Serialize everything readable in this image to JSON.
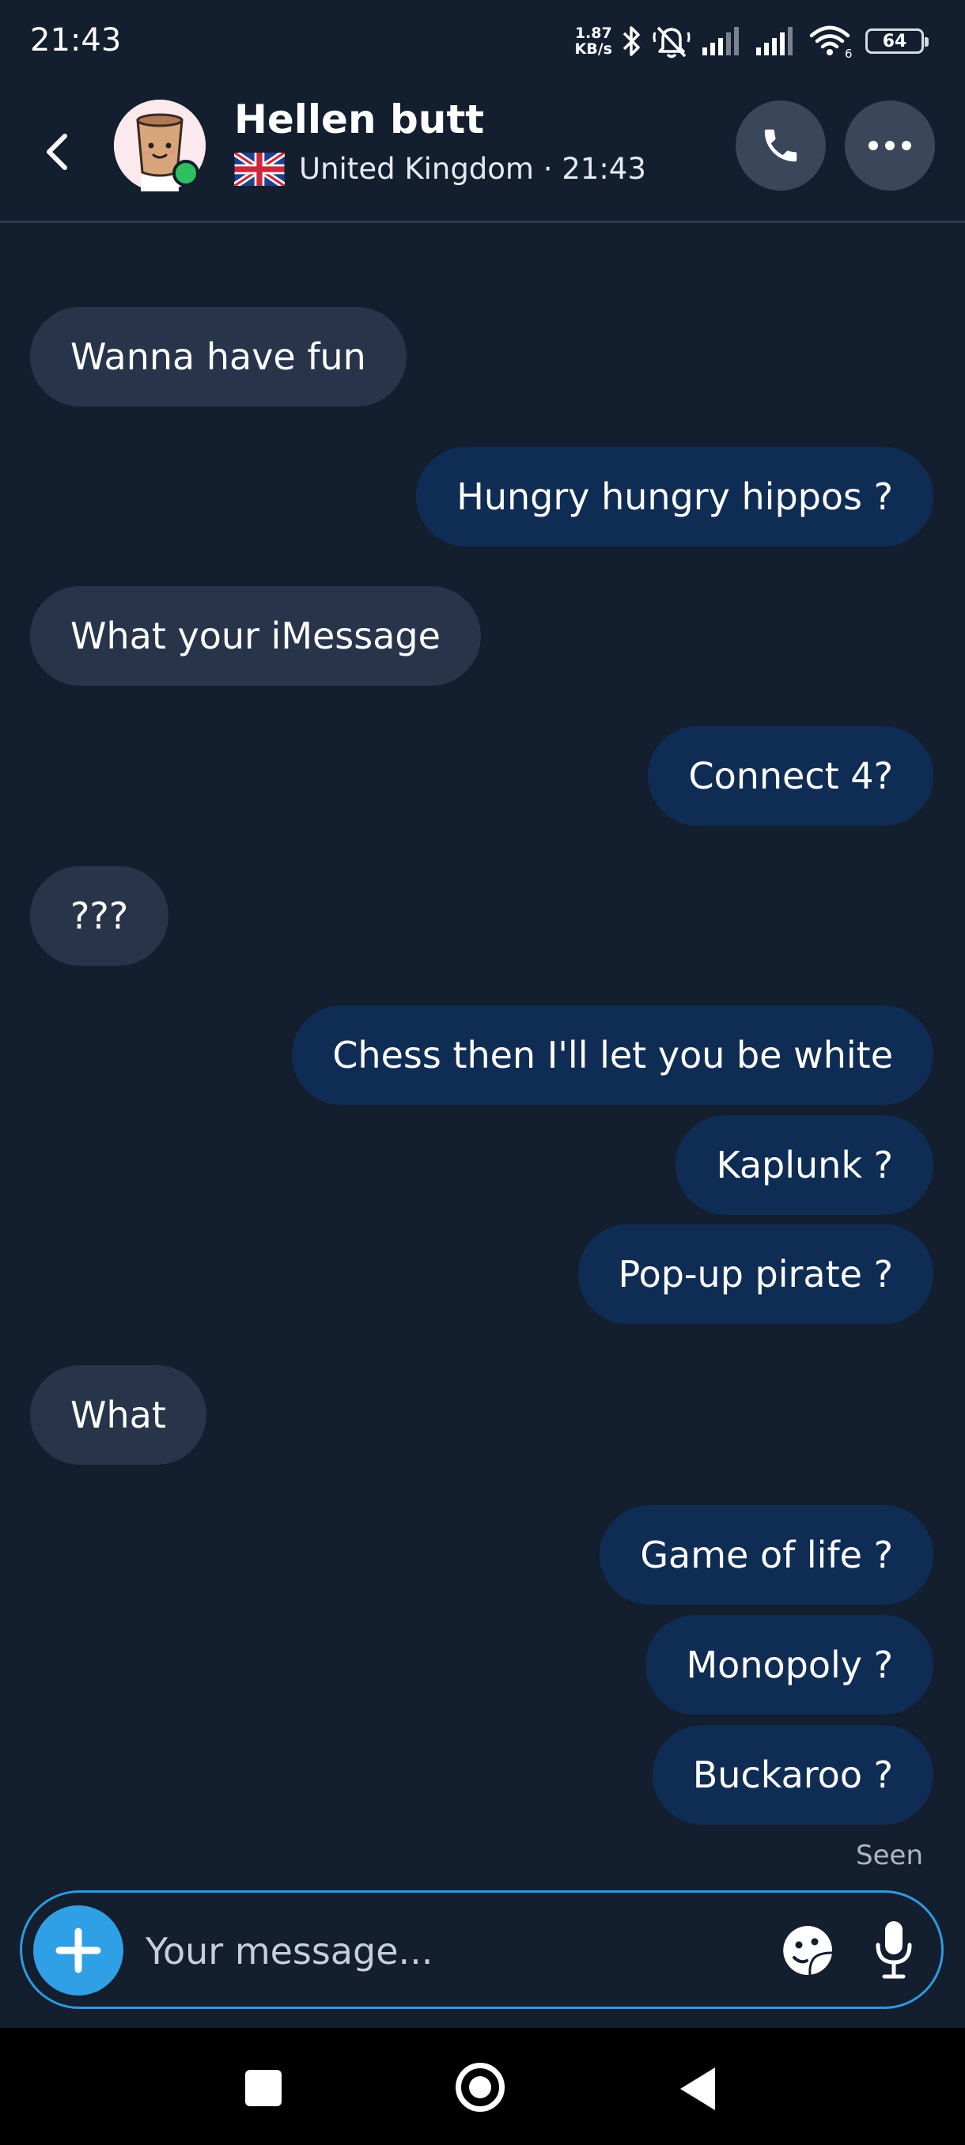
{
  "status_bar": {
    "time": "21:43",
    "net_speed_value": "1.87",
    "net_speed_unit": "KB/s",
    "wifi_badge": "6",
    "battery": "64",
    "icons": [
      "bluetooth-icon",
      "silent-mode-icon",
      "signal-icon",
      "signal-icon",
      "wifi-icon",
      "battery-icon"
    ]
  },
  "header": {
    "back_icon": "chevron-left-icon",
    "contact_name": "Hellen butt",
    "country": "United Kingdom · 21:43",
    "flag": "uk-flag-icon",
    "online": true,
    "call_icon": "phone-icon",
    "more_icon": "more-horizontal-icon"
  },
  "messages": [
    {
      "text": "Wanna have fun",
      "direction": "in"
    },
    {
      "text": "Hungry hungry hippos ?",
      "direction": "out"
    },
    {
      "text": "What your iMessage",
      "direction": "in"
    },
    {
      "text": "Connect 4?",
      "direction": "out"
    },
    {
      "text": "???",
      "direction": "in"
    },
    {
      "text": "Chess then I'll let you be white",
      "direction": "out"
    },
    {
      "text": "Kaplunk ?",
      "direction": "out"
    },
    {
      "text": "Pop-up pirate ?",
      "direction": "out"
    },
    {
      "text": "What",
      "direction": "in"
    },
    {
      "text": "Game of life ?",
      "direction": "out"
    },
    {
      "text": "Monopoly ?",
      "direction": "out"
    },
    {
      "text": "Buckaroo ?",
      "direction": "out"
    }
  ],
  "seen_label": "Seen",
  "composer": {
    "placeholder": "Your message...",
    "icons": [
      "plus-icon",
      "sticker-icon",
      "microphone-icon"
    ]
  },
  "colors": {
    "background": "#131e2f",
    "incoming_bubble": "#27344a",
    "outgoing_bubble": "#0f2d54",
    "accent": "#2f9fe6",
    "online": "#2fbf5f"
  }
}
